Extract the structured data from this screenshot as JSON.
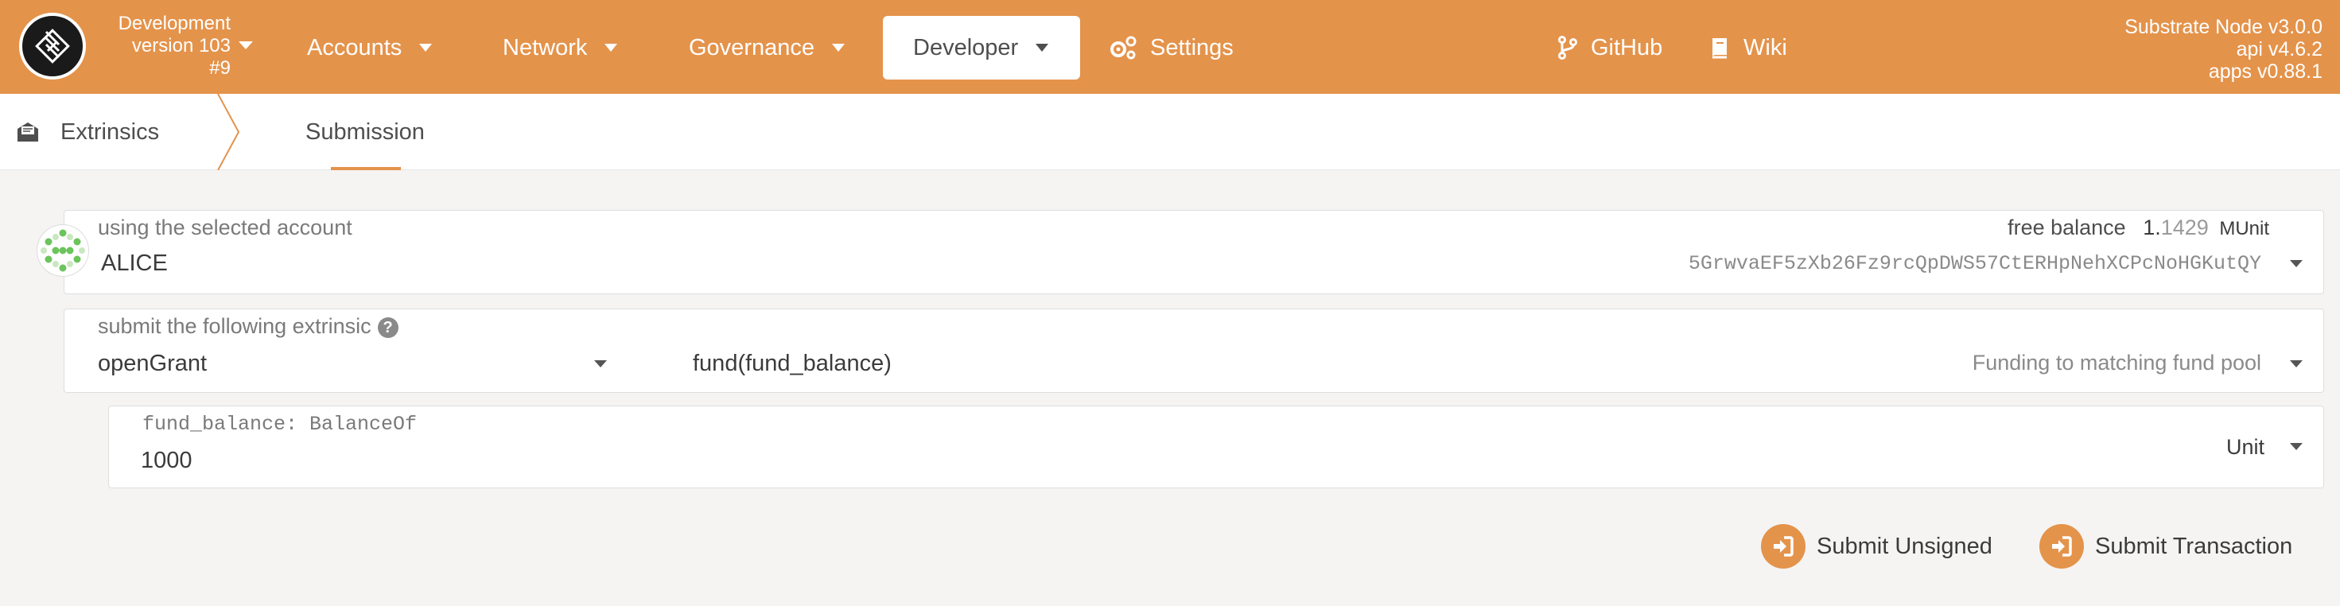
{
  "header": {
    "chain_name": "Development",
    "chain_version": "version 103",
    "chain_block": "#9",
    "nav": {
      "accounts": "Accounts",
      "network": "Network",
      "governance": "Governance",
      "developer": "Developer",
      "settings": "Settings",
      "github": "GitHub",
      "wiki": "Wiki"
    },
    "node": {
      "name": "Substrate Node v3.0.0",
      "api": "api v4.6.2",
      "apps": "apps v0.88.1"
    }
  },
  "tabs": {
    "main": "Extrinsics",
    "sub": "Submission"
  },
  "account": {
    "label": "using the selected account",
    "name": "ALICE",
    "balance_label": "free balance",
    "balance_int": "1.",
    "balance_dec": "1429",
    "balance_unit": "MUnit",
    "address": "5GrwvaEF5zXb26Fz9rcQpDWS57CtERHpNehXCPcNoHGKutQY"
  },
  "extrinsic": {
    "label": "submit the following extrinsic",
    "help": "?",
    "module": "openGrant",
    "call": "fund(fund_balance)",
    "description": "Funding to matching fund pool"
  },
  "param": {
    "label": "fund_balance: BalanceOf",
    "value": "1000",
    "unit": "Unit"
  },
  "actions": {
    "unsigned": "Submit Unsigned",
    "transaction": "Submit Transaction"
  },
  "colors": {
    "brand": "#e4934b",
    "bar_text": "#ffffff",
    "text": "#4e4e4e"
  }
}
